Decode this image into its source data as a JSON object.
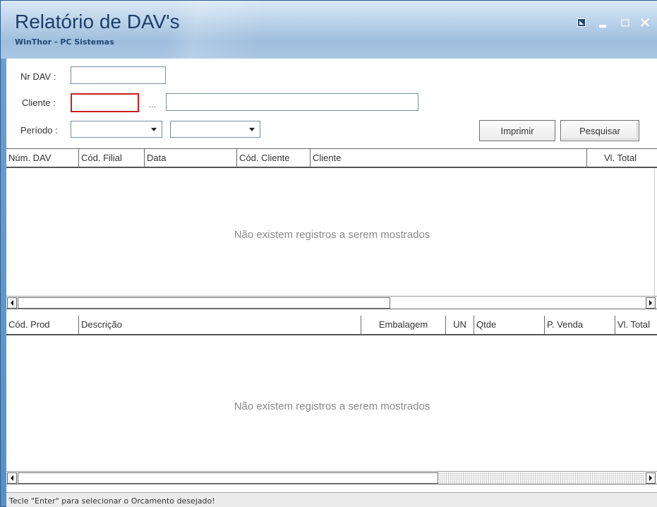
{
  "window": {
    "title": "Relatório de DAV's",
    "subtitle": "WinThor - PC Sistemas"
  },
  "form": {
    "nr_dav_label": "Nr DAV :",
    "nr_dav_value": "",
    "cliente_label": "Cliente :",
    "cliente_code_value": "",
    "cliente_lookup": "...",
    "cliente_name_value": "",
    "periodo_label": "Período :",
    "periodo_start": "",
    "periodo_end": ""
  },
  "buttons": {
    "imprimir": "Imprimir",
    "pesquisar": "Pesquisar"
  },
  "grid_dav": {
    "columns": [
      "Núm. DAV",
      "Cód. Filial",
      "Data",
      "Cód. Cliente",
      "Cliente",
      "Vl. Total"
    ],
    "empty_message": "Não existem registros a serem mostrados"
  },
  "grid_itens": {
    "columns": [
      "Cód. Prod",
      "Descrição",
      "Embalagem",
      "UN",
      "Qtde",
      "P. Venda",
      "Vl. Total"
    ],
    "empty_message": "Não existem registros a serem mostrados"
  },
  "status": {
    "text": "Tecle \"Enter\" para selecionar o Orcamento desejado!"
  },
  "colors": {
    "highlight_border": "#c82020",
    "titlebar_text": "#1d3f66",
    "frame": "#5a8fc4"
  }
}
